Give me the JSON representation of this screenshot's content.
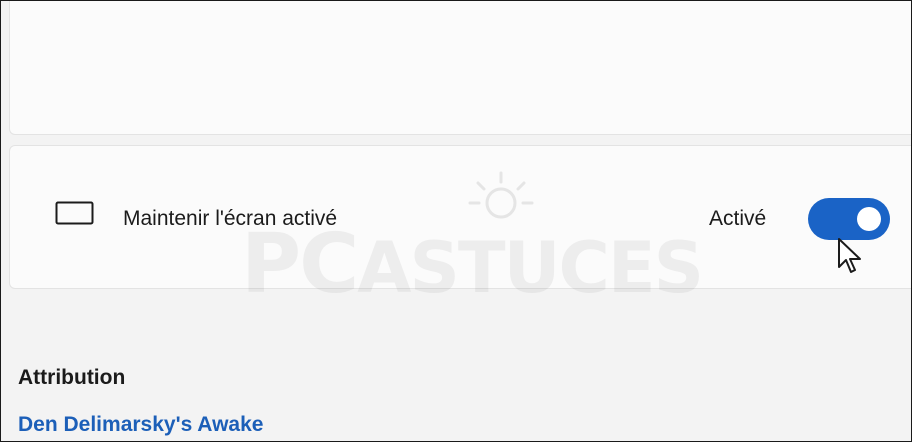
{
  "setting": {
    "icon": "monitor-icon",
    "label": "Maintenir l'écran activé",
    "state_label": "Activé",
    "toggle_on": true,
    "accent_color": "#1a63c6"
  },
  "attribution": {
    "title": "Attribution",
    "link_text": "Den Delimarsky's Awake",
    "link_color": "#1c5fb8"
  },
  "watermark": {
    "prefix": "PC",
    "suffix": "ASTUCES"
  }
}
